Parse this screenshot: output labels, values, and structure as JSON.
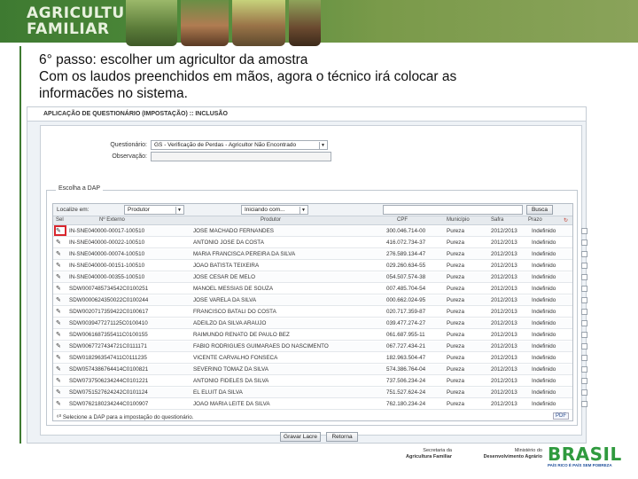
{
  "banner": {
    "brand_line1": "AGRICULTURA",
    "brand_line2": "FAMILIAR"
  },
  "caption": {
    "line1": "6° passo: escolher um agricultor da amostra",
    "line2": "Com os laudos preenchidos em mãos, agora o técnico irá colocar as",
    "line3": "informacões no sistema."
  },
  "app": {
    "title": "APLICAÇÃO DE QUESTIONÁRIO (IMPOSTAÇÃO) :: INCLUSÃO",
    "questionario_label": "Questionário:",
    "questionario_value": "GS - Verificação de Perdas - Agricultor Não Encontrado",
    "observacao_label": "Observação:",
    "legend": "Escolha a DAP",
    "filter": {
      "label": "Localize em:",
      "field_value": "Produtor",
      "match_value": "Iniciando com...",
      "search_button": "Busca"
    },
    "columns": [
      "Sel",
      "Nº Externo",
      "Produtor",
      "CPF",
      "Município",
      "Safra",
      "Prazo"
    ],
    "rows": [
      {
        "ext": "IN-SNE040000-00017-100510",
        "produtor": "JOSE MACHADO FERNANDES",
        "cpf": "300.046.714-00",
        "mun": "Pureza",
        "safra": "2012/2013",
        "prazo": "Indefinido"
      },
      {
        "ext": "IN-SNE040000-00022-100510",
        "produtor": "ANTONIO JOSE DA COSTA",
        "cpf": "416.072.734-37",
        "mun": "Pureza",
        "safra": "2012/2013",
        "prazo": "Indefinido"
      },
      {
        "ext": "IN-SNE040000-00074-100510",
        "produtor": "MARIA FRANCISCA PEREIRA DA SILVA",
        "cpf": "276.589.134-47",
        "mun": "Pureza",
        "safra": "2012/2013",
        "prazo": "Indefinido"
      },
      {
        "ext": "IN-SNE040000-00151-100510",
        "produtor": "JOÃO BATISTA TEIXEIRA",
        "cpf": "029.260.634-55",
        "mun": "Pureza",
        "safra": "2012/2013",
        "prazo": "Indefinido"
      },
      {
        "ext": "IN-SNE040000-00355-100510",
        "produtor": "JOSE CESAR DE MELO",
        "cpf": "054.507.574-38",
        "mun": "Pureza",
        "safra": "2012/2013",
        "prazo": "Indefinido"
      },
      {
        "ext": "SDW0007485734542C0100251",
        "produtor": "MANOEL MESSIAS DE SOUZA",
        "cpf": "007.485.704-54",
        "mun": "Pureza",
        "safra": "2012/2013",
        "prazo": "Indefinido"
      },
      {
        "ext": "SDW0000624350022C0100244",
        "produtor": "JOSE VARELA DA SILVA",
        "cpf": "000.662.024-95",
        "mun": "Pureza",
        "safra": "2012/2013",
        "prazo": "Indefinido"
      },
      {
        "ext": "SDW0020717359422C0100617",
        "produtor": "FRANCISCO BATALI DO COSTA",
        "cpf": "020.717.359-87",
        "mun": "Pureza",
        "safra": "2012/2013",
        "prazo": "Indefinido"
      },
      {
        "ext": "SDW0039477271125C0100410",
        "produtor": "ADEILZO DA SILVA ARAUJO",
        "cpf": "039.477.274-27",
        "mun": "Pureza",
        "safra": "2012/2013",
        "prazo": "Indefinido"
      },
      {
        "ext": "SDW0061687355411C0100155",
        "produtor": "RAIMUNDO RENATO DE PAULO BEZ",
        "cpf": "061.687.955-11",
        "mun": "Pureza",
        "safra": "2012/2013",
        "prazo": "Indefinido"
      },
      {
        "ext": "SDW0067727434721C0111171",
        "produtor": "FABIO RODRIGUES GUIMARAES DO NASCIMENTO",
        "cpf": "067.727.434-21",
        "mun": "Pureza",
        "safra": "2012/2013",
        "prazo": "Indefinido"
      },
      {
        "ext": "SDW0182963547411C0111235",
        "produtor": "VICENTE CARVALHO FONSECA",
        "cpf": "182.963.504-47",
        "mun": "Pureza",
        "safra": "2012/2013",
        "prazo": "Indefinido"
      },
      {
        "ext": "SDW0574386764414C0100821",
        "produtor": "SEVERINO TOMAZ DA SILVA",
        "cpf": "574.386.764-04",
        "mun": "Pureza",
        "safra": "2012/2013",
        "prazo": "Indefinido"
      },
      {
        "ext": "SDW0737506234244C0101221",
        "produtor": "ANTONIO FIDELES DA SILVA",
        "cpf": "737.506.234-24",
        "mun": "Pureza",
        "safra": "2012/2013",
        "prazo": "Indefinido"
      },
      {
        "ext": "SDW0751527624242C0101124",
        "produtor": "EL ELUIT DA SILVA",
        "cpf": "751.527.624-24",
        "mun": "Pureza",
        "safra": "2012/2013",
        "prazo": "Indefinido"
      },
      {
        "ext": "SDW0762180234244C0100907",
        "produtor": "JOÃO MARIA LEITE DA SILVA",
        "cpf": "762.180.234-24",
        "mun": "Pureza",
        "safra": "2012/2013",
        "prazo": "Indefinido"
      }
    ],
    "footer_note": "Selecione a DAP para a impostação do questionário.",
    "pdf_label": "PDF",
    "confirm_button": "Gravar Lacre",
    "back_button": "Retorna"
  },
  "footer": {
    "sec_line1": "Secretaria da",
    "sec_line2": "Agricultura Familiar",
    "min_line1": "Ministério do",
    "min_line2": "Desenvolvimento Agrário",
    "brasil": "BRASIL",
    "brasil_tag": "PAÍS RICO É PAÍS SEM POBREZA"
  },
  "colors": {
    "banner_green": "#3e7a31",
    "highlight_red": "#d9262d",
    "brasil_green": "#2f9a3e",
    "brasil_blue": "#1f4f9b"
  }
}
